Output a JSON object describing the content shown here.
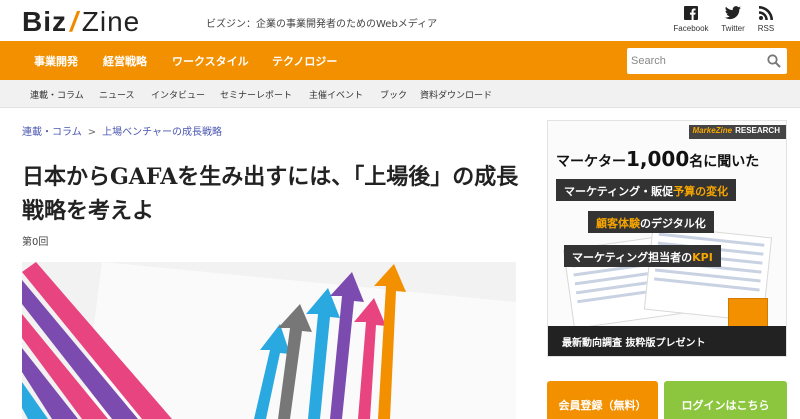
{
  "header": {
    "logo_left": "Biz",
    "logo_slash": "/",
    "logo_right": "Zine",
    "tagline": "ビズジン：企業の事業開発者のためのWebメディア",
    "social": [
      {
        "label": "Facebook",
        "icon": "facebook-icon"
      },
      {
        "label": "Twitter",
        "icon": "twitter-icon"
      },
      {
        "label": "RSS",
        "icon": "rss-icon"
      }
    ]
  },
  "main_nav": {
    "items": [
      "事業開発",
      "経営戦略",
      "ワークスタイル",
      "テクノロジー"
    ],
    "search_placeholder": "Search"
  },
  "sub_nav": {
    "items": [
      "連載・コラム",
      "ニュース",
      "インタビュー",
      "セミナーレポート",
      "主催イベント",
      "ブック",
      "資料ダウンロード"
    ]
  },
  "breadcrumb": {
    "items": [
      "連載・コラム",
      "上場ベンチャーの成長戦略"
    ],
    "separator": ">"
  },
  "article": {
    "title": "日本からGAFAを生み出すには、「上場後」の成長戦略を考えよ",
    "episode": "第0回"
  },
  "ad": {
    "brand_name": "MarkeZine",
    "brand_tag": "RESEARCH",
    "heading_pre": "マーケター",
    "heading_number": "1,000",
    "heading_post": "名に聞いた",
    "band1_pre": "マーケティング・販促",
    "band1_hl": "予算の変化",
    "band2_hl": "顧客体験",
    "band2_post": "のデジタル化",
    "band3_pre": "マーケティング担当者の",
    "band3_hl": "KPI",
    "footer": "最新動向調査 抜粋版プレゼント"
  },
  "buttons": {
    "register": "会員登録（無料）",
    "login": "ログインはこちら"
  },
  "colors": {
    "brand_orange": "#f29000",
    "login_green": "#8cc63e",
    "link_blue": "#4a56b0",
    "subnav_bg": "#f1f1f1"
  }
}
